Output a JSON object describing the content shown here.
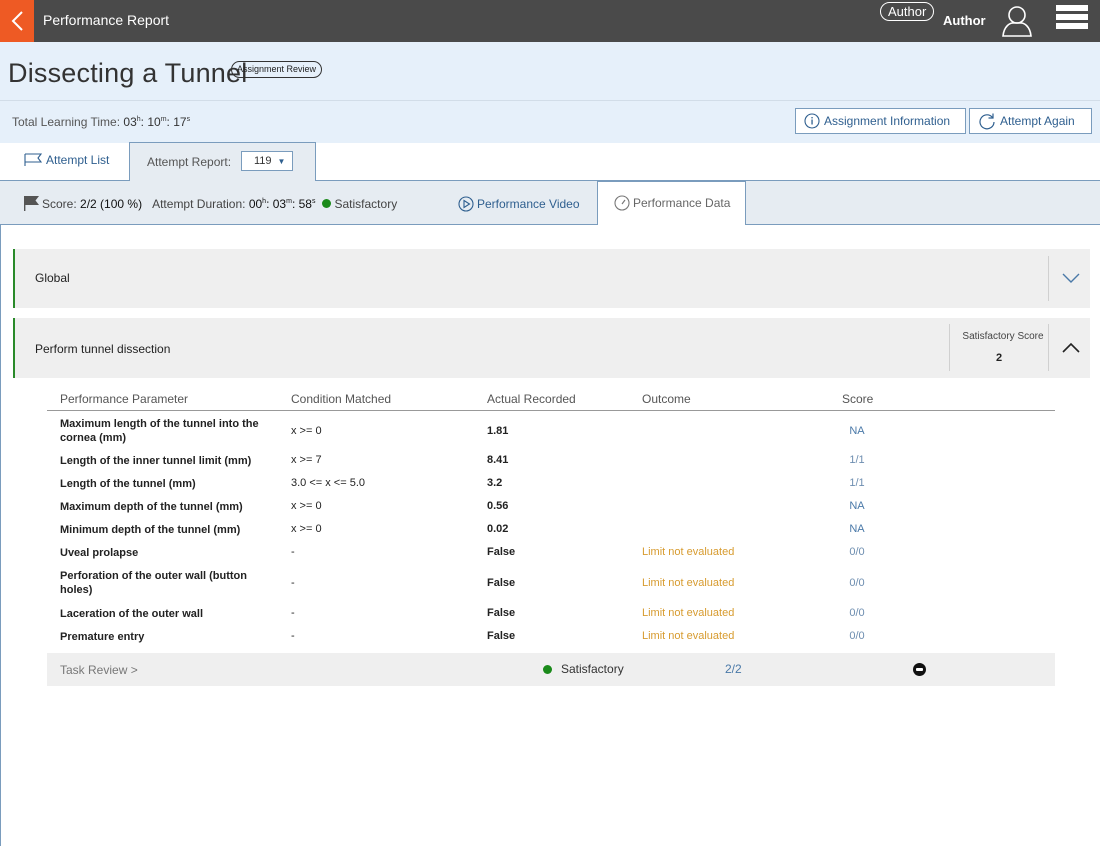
{
  "topbar": {
    "title": "Performance Report",
    "role_badge": "Author",
    "user_name": "Author",
    "icons": {
      "back": "chevron-left-icon",
      "user": "user-icon",
      "menu": "menu-icon"
    },
    "colors": {
      "bar": "#4a4a4a",
      "back": "#ee5a24"
    }
  },
  "header": {
    "title": "Dissecting a Tunnel",
    "badge": "Assignment Review",
    "learning_time_label": "Total Learning Time:",
    "learning_time": {
      "h": "03",
      "m": "10",
      "s": "17"
    },
    "buttons": {
      "info": "Assignment Information",
      "again": "Attempt Again"
    }
  },
  "tabs": {
    "attempt_list": "Attempt List",
    "attempt_report": "Attempt Report:",
    "attempt_selected": "119"
  },
  "scorebar": {
    "score_label": "Score:",
    "score_value": "2/2 (100 %)",
    "duration_label": "Attempt Duration:",
    "duration": {
      "h": "00",
      "m": "03",
      "s": "58"
    },
    "status": "Satisfactory",
    "video_tab": "Performance Video",
    "data_tab": "Performance Data"
  },
  "sections": {
    "global": {
      "label": "Global"
    },
    "task": {
      "label": "Perform tunnel dissection",
      "sat_score_label": "Satisfactory Score",
      "sat_score_value": "2"
    }
  },
  "table": {
    "headers": [
      "Performance Parameter",
      "Condition Matched",
      "Actual Recorded",
      "Outcome",
      "Score"
    ],
    "rows": [
      {
        "param": "Maximum length of the tunnel into the cornea (mm)",
        "cond": "x >= 0",
        "actual": "1.81",
        "outcome": "",
        "score": "NA"
      },
      {
        "param": "Length of the inner tunnel limit (mm)",
        "cond": "x >= 7",
        "actual": "8.41",
        "outcome": "",
        "score": "1/1"
      },
      {
        "param": "Length of the tunnel (mm)",
        "cond": "3.0 <= x <= 5.0",
        "actual": "3.2",
        "outcome": "",
        "score": "1/1"
      },
      {
        "param": "Maximum depth of the tunnel (mm)",
        "cond": "x >= 0",
        "actual": "0.56",
        "outcome": "",
        "score": "NA"
      },
      {
        "param": "Minimum depth of the tunnel (mm)",
        "cond": "x >= 0",
        "actual": "0.02",
        "outcome": "",
        "score": "NA"
      },
      {
        "param": "Uveal prolapse",
        "cond": "-",
        "actual": "False",
        "outcome": "Limit not evaluated",
        "score": "0/0"
      },
      {
        "param": "Perforation of the outer wall (button holes)",
        "cond": "-",
        "actual": "False",
        "outcome": "Limit not evaluated",
        "score": "0/0"
      },
      {
        "param": "Laceration of the outer wall",
        "cond": "-",
        "actual": "False",
        "outcome": "Limit not evaluated",
        "score": "0/0"
      },
      {
        "param": "Premature entry",
        "cond": "-",
        "actual": "False",
        "outcome": "Limit not evaluated",
        "score": "0/0"
      }
    ]
  },
  "footer": {
    "review_link": "Task Review >",
    "status": "Satisfactory",
    "score": "2/2"
  }
}
